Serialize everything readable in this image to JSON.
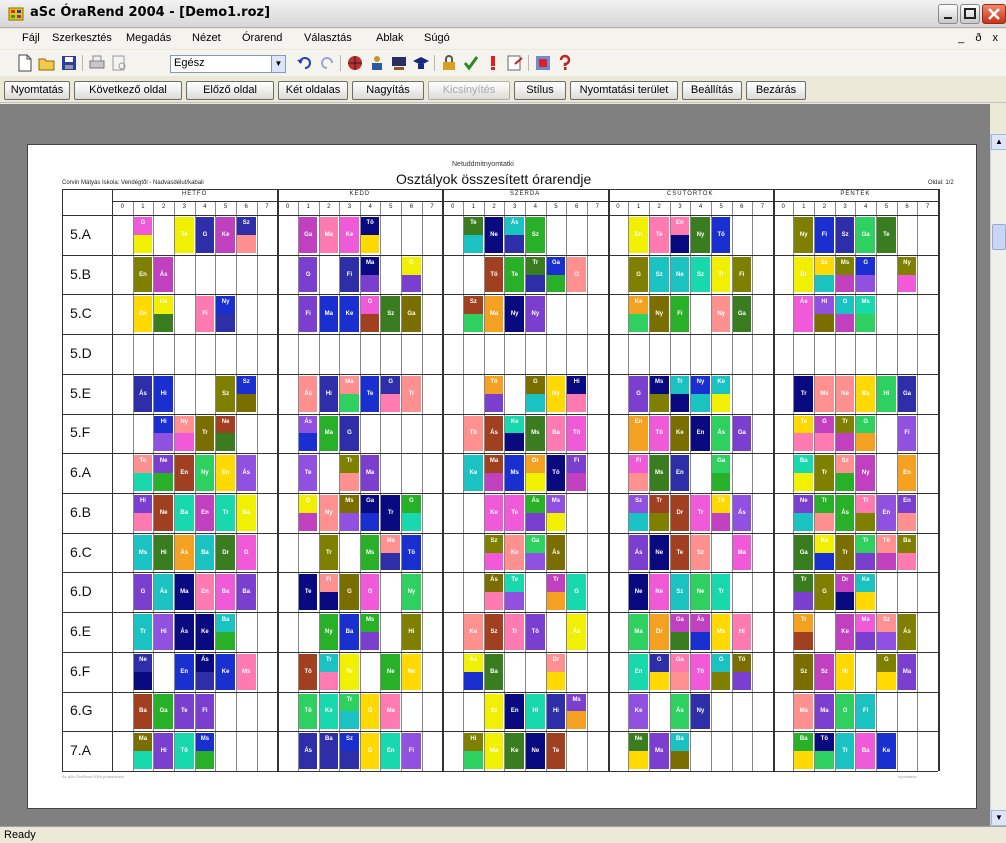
{
  "window": {
    "title": "aSc ÓraRend 2004  - [Demo1.roz]",
    "mdi_controls": "_ ð x"
  },
  "menu": [
    {
      "label": "Fájl"
    },
    {
      "label": "Szerkesztés"
    },
    {
      "label": "Megadás"
    },
    {
      "label": "Nézet"
    },
    {
      "label": "Órarend"
    },
    {
      "label": "Választás"
    },
    {
      "label": "Ablak"
    },
    {
      "label": "Súgó"
    }
  ],
  "toolbar": {
    "scope_value": "Egész",
    "icons": [
      "new-icon",
      "open-icon",
      "save-icon",
      "print-icon",
      "preview-icon",
      "undo-icon",
      "redo-icon",
      "globe-icon",
      "teacher-icon",
      "classroom-icon",
      "graduate-icon",
      "lock-icon",
      "check-icon",
      "exclamation-icon",
      "card-icon",
      "settings-icon",
      "help-icon"
    ]
  },
  "preview_buttons": [
    {
      "label": "Nyomtatás",
      "enabled": true
    },
    {
      "label": "Következő oldal",
      "enabled": true
    },
    {
      "label": "Előző oldal",
      "enabled": true
    },
    {
      "label": "Két oldalas",
      "enabled": true
    },
    {
      "label": "Nagyítás",
      "enabled": true
    },
    {
      "label": "Kicsinyítés",
      "enabled": false
    },
    {
      "label": "Stílus",
      "enabled": true
    },
    {
      "label": "Nyomtatási terület",
      "enabled": true
    },
    {
      "label": "Beállítás",
      "enabled": true
    },
    {
      "label": "Bezárás",
      "enabled": true
    }
  ],
  "status": "Ready",
  "page": {
    "subtitle": "Netuddmitnyomtatki",
    "title": "Osztályok összesített órarendje",
    "left_header": "Corvin Mátyás Iskola: Vendégtől - Nadvasdélut/kabali",
    "right_header": "Oldal: 1/2",
    "footer_left": "Az aSc ÓraRend 2004 próbaverzió",
    "footer_right": "nyomtatva",
    "days": [
      "HÉTFŐ",
      "KEDD",
      "SZERDA",
      "CSÜTÖRTÖK",
      "PÉNTEK"
    ],
    "periods": [
      "0",
      "1",
      "2",
      "3",
      "4",
      "5",
      "6",
      "7"
    ],
    "classes": [
      "5.A",
      "5.B",
      "5.C",
      "5.D",
      "5.E",
      "5.F",
      "6.A",
      "6.B",
      "6.C",
      "6.D",
      "6.E",
      "6.F",
      "6.G",
      "7.A"
    ]
  },
  "colors": {
    "palette": [
      "#1a2fd0",
      "#2e2ea8",
      "#7a3fcf",
      "#c040c0",
      "#f05ad8",
      "#ff7ab0",
      "#f4a020",
      "#ffd900",
      "#f0f000",
      "#1ac2c2",
      "#18d8ae",
      "#2ed060",
      "#28b028",
      "#808000",
      "#a04020",
      "#0a0a80",
      "#7a6e00",
      "#3a7d20",
      "#ff9090",
      "#9050e0"
    ]
  },
  "cell_labels": [
    "Ás",
    "Tr",
    "Ma",
    "Ms",
    "Te",
    "Tö",
    "Fi",
    "Ga",
    "G",
    "Ke",
    "Hi",
    "Ne",
    "Ny",
    "Ba",
    "En",
    "Dr",
    "Sz"
  ]
}
